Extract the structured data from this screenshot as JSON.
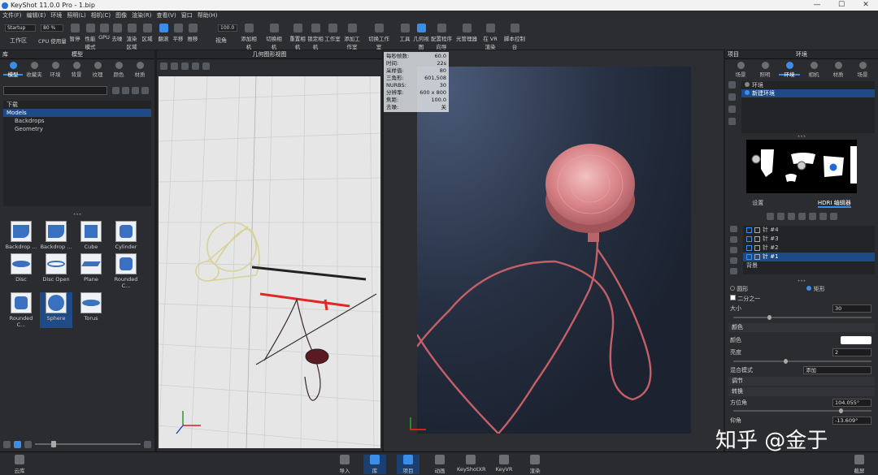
{
  "window": {
    "title": "KeyShot 11.0.0 Pro  -  1.bip",
    "min": "—",
    "max": "☐",
    "close": "✕"
  },
  "menu": [
    "文件(F)",
    "编辑(E)",
    "环境",
    "照明(L)",
    "相机(C)",
    "图像",
    "渲染(R)",
    "查看(V)",
    "窗口",
    "帮助(H)"
  ],
  "toolbar": {
    "workspace_select": "Startup",
    "workspace_label": "工作区",
    "cpu_percent": "80 %",
    "cpu_label": "CPU 使用量",
    "pause": "暂停",
    "perf_mode": "性能模式",
    "gpu": "GPU",
    "denoise": "去噪",
    "render_region": "渲染区域",
    "region": "区域",
    "tumble": "翻滚",
    "pan": "平移",
    "dolly": "推移",
    "fov_value": "100.0",
    "fov_label": "视角",
    "add_camera": "添加相机",
    "switch_camera": "切换相机",
    "reset_camera": "重置相机",
    "lock_camera": "锁定相机",
    "studio": "工作室",
    "add_studio": "添加工作室",
    "switch_studio": "切换工作室",
    "tools": "工具",
    "geometry_view": "几何视图",
    "config_wizard": "配置程序向导",
    "light_manager": "光管理器",
    "vr_render": "在 VR 渲染",
    "script_console": "脚本控制台"
  },
  "library": {
    "title": "库",
    "models_title": "模型",
    "tabs": [
      "模型",
      "收藏夹",
      "环境",
      "背景",
      "纹理",
      "颜色",
      "材质"
    ],
    "tree": [
      "下载",
      "Models",
      "Backdrops",
      "Geometry"
    ],
    "models": [
      "Backdrop ...",
      "Backdrop ...",
      "Cube",
      "Cylinder",
      "Disc",
      "Disc Open",
      "Plane",
      "Rounded C...",
      "Rounded C...",
      "Sphere",
      "Torus"
    ]
  },
  "geometry_view": {
    "title": "几何图形视图"
  },
  "render_stats": {
    "rows": [
      [
        "每秒帧数:",
        "60.0"
      ],
      [
        "时间:",
        "22s"
      ],
      [
        "采样值:",
        "80"
      ],
      [
        "三角形:",
        "601,508"
      ],
      [
        "NURBS:",
        "30"
      ],
      [
        "分辨率:",
        "600 x 800"
      ],
      [
        "焦距:",
        "100.0"
      ],
      [
        "去噪:",
        "关"
      ]
    ]
  },
  "project": {
    "title": "项目",
    "env_title": "环境",
    "tabs": [
      "场景",
      "照明",
      "环境",
      "相机",
      "材质",
      "场景"
    ],
    "env_list": [
      "环境",
      "新建环境"
    ],
    "subtabs": [
      "设置",
      "HDRI 编辑器"
    ],
    "pins": [
      "针 #4",
      "针 #3",
      "针 #2",
      "针 #1",
      "背景"
    ],
    "mode_circle": "圆形",
    "mode_rect": "矩形",
    "half": "二分之一",
    "size_label": "大小",
    "size_value": "30",
    "color_section": "颜色",
    "color_label": "颜色",
    "brightness_label": "亮度",
    "brightness_value": "2",
    "blend_label": "混合模式",
    "blend_value": "添加",
    "adjust_section": "调节",
    "transform_section": "转换",
    "azimuth_label": "方位角",
    "azimuth_value": "104.055°",
    "elevation_label": "仰角",
    "elevation_value": "-13.609°"
  },
  "bottom": {
    "cloud": "云库",
    "import": "导入",
    "library": "库",
    "project": "项目",
    "animation": "动画",
    "keyshotxr": "KeyShotXR",
    "keyvr": "KeyVR",
    "render": "渲染",
    "screenshot": "截屏"
  },
  "watermark": "知乎 @金于",
  "colors": {
    "accent": "#3b8ee8",
    "selection": "#1e4a86",
    "render_bg": "#2a3344",
    "cable": "#c86067"
  }
}
